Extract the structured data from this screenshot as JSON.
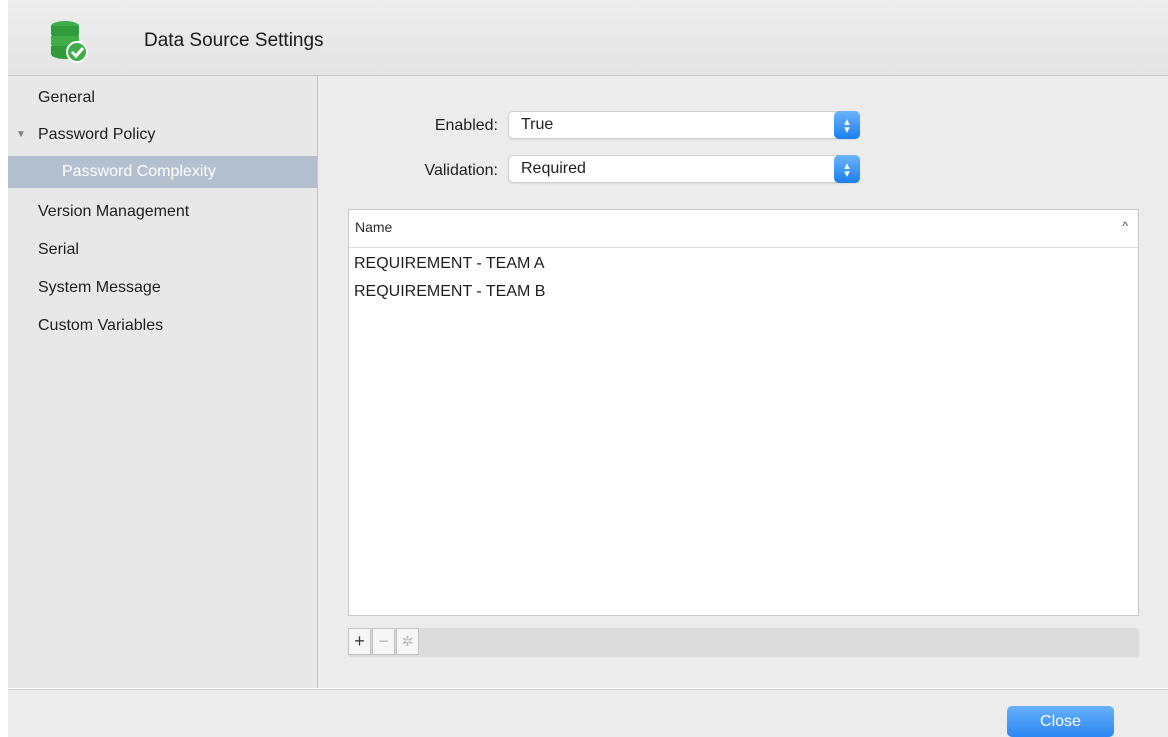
{
  "window": {
    "title": "Data Source Settings",
    "icon": "database-check-icon"
  },
  "sidebar": {
    "items": [
      {
        "label": "General"
      },
      {
        "label": "Password Policy",
        "expanded": true
      },
      {
        "label": "Password Complexity",
        "selected": true
      },
      {
        "label": "Version Management"
      },
      {
        "label": "Serial"
      },
      {
        "label": "System Message"
      },
      {
        "label": "Custom Variables"
      }
    ],
    "disclosure_icon": "▼"
  },
  "form": {
    "enabled_label": "Enabled:",
    "enabled_value": "True",
    "validation_label": "Validation:",
    "validation_value": "Required"
  },
  "table": {
    "column_header": "Name",
    "sort_indicator": "^",
    "rows": [
      "REQUIREMENT - TEAM A",
      "REQUIREMENT - TEAM B"
    ]
  },
  "toolbar": {
    "add": "+",
    "remove": "−",
    "settings": "✲"
  },
  "footer": {
    "close_label": "Close"
  },
  "colors": {
    "accent": "#2d87f3",
    "selection": "#b4bfcf",
    "icon_green": "#3fae49"
  }
}
